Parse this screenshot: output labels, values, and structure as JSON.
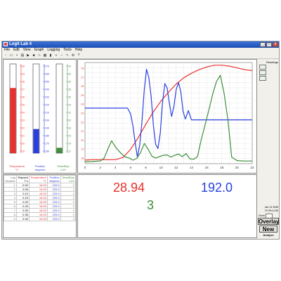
{
  "window": {
    "title": "Logit Lab 4"
  },
  "menu": [
    "File",
    "Edit",
    "View",
    "Graph",
    "Logging",
    "Tools",
    "Help"
  ],
  "meters": [
    {
      "name": "Temperature",
      "unit": "°C",
      "color": "#e8312c",
      "ticks": [
        "30",
        "29",
        "28",
        "27",
        "26",
        "25",
        "24",
        "23",
        "22",
        "21",
        "20",
        "19"
      ],
      "level": 0.73
    },
    {
      "name": "Position",
      "unit": "degrees",
      "color": "#2a3fe0",
      "ticks": [
        "270",
        "260",
        "250",
        "240",
        "230",
        "220",
        "210",
        "200",
        "190",
        "180",
        "170",
        "160"
      ],
      "level": 0.27
    },
    {
      "name": "SmartEye",
      "unit": "LUX",
      "color": "#3e8f3b",
      "ticks": [
        "34",
        "32",
        "30",
        "28",
        "26",
        "24",
        "22",
        "20",
        "18",
        "16",
        "14",
        "12"
      ],
      "level": 0.06
    }
  ],
  "table": {
    "headers": [
      "Log Number",
      "Elapsed T s",
      "Temperature °C",
      "Position degrees",
      "SmartEye LUX"
    ],
    "rows": [
      [
        "1",
        "0.00",
        "18.05",
        "225.9",
        "2"
      ],
      [
        "2",
        "0.05",
        "18.05",
        "225.9",
        "2"
      ],
      [
        "3",
        "0.10",
        "18.05",
        "225.9",
        "2"
      ],
      [
        "4",
        "0.15",
        "18.05",
        "225.9",
        "2"
      ],
      [
        "5",
        "0.20",
        "18.05",
        "225.9",
        "2"
      ],
      [
        "6",
        "0.25",
        "18.05",
        "225.9",
        "2"
      ],
      [
        "7",
        "0.30",
        "18.05",
        "225.9",
        "2"
      ],
      [
        "8",
        "0.35",
        "18.05",
        "225.9",
        "2"
      ],
      [
        "9",
        "0.40",
        "18.05",
        "225.9",
        "2"
      ]
    ]
  },
  "readouts": {
    "temperature": "28.94",
    "position": "192.0",
    "light": "3"
  },
  "sidebar": {
    "top_label": "Readings",
    "date": "Jan 13 2008",
    "time": "Fri 09:41:55",
    "zoom_label": "Zoom",
    "overlay_label": "Overlay",
    "new_label": "New",
    "analyse_label": "Analyse"
  },
  "chart_data": {
    "type": "line",
    "x_ticks": [
      "0",
      "2",
      "4",
      "6",
      "8",
      "10",
      "12",
      "14",
      "16",
      "18",
      "20",
      "22"
    ],
    "xlim": [
      0,
      22
    ],
    "left_ticks": [
      "28",
      "27",
      "26",
      "25",
      "24",
      "23",
      "22",
      "21",
      "20",
      "19",
      "18"
    ],
    "grid": true,
    "series": [
      {
        "name": "Temperature",
        "color": "#e8312c",
        "x": [
          0,
          1,
          2,
          3,
          4,
          5,
          6,
          7,
          8,
          9,
          10,
          11,
          12,
          13,
          14,
          15,
          16,
          17,
          18,
          19,
          20,
          21,
          22
        ],
        "y": [
          18.0,
          18.05,
          18.05,
          18.05,
          18.05,
          18.3,
          19.2,
          20.5,
          22.0,
          23.4,
          24.6,
          25.6,
          26.5,
          27.2,
          27.7,
          28.1,
          28.4,
          28.6,
          28.6,
          28.5,
          28.3,
          28.1,
          28.0
        ]
      },
      {
        "name": "Position",
        "color": "#2a3fe0",
        "x": [
          0,
          1,
          2,
          3,
          4,
          5,
          5.6,
          6,
          6.3,
          6.6,
          6.9,
          7.2,
          7.5,
          7.8,
          8.1,
          8.4,
          8.7,
          9,
          9.3,
          9.6,
          9.9,
          10.2,
          10.5,
          10.8,
          11.1,
          11.4,
          11.7,
          12,
          12.3,
          12.6,
          12.9,
          13.2,
          13.6,
          14,
          15,
          16,
          18,
          20,
          22
        ],
        "y": [
          225.9,
          225.9,
          225.9,
          225.9,
          225.9,
          225.9,
          225.9,
          219,
          205,
          185,
          168,
          182,
          210,
          248,
          272,
          262,
          240,
          205,
          183,
          178,
          196,
          232,
          255,
          250,
          232,
          216,
          228,
          248,
          256,
          246,
          222,
          213,
          223,
          212,
          212,
          212,
          212,
          212,
          212
        ]
      },
      {
        "name": "SmartEye",
        "color": "#3e8f3b",
        "x": [
          0,
          1,
          2,
          2.5,
          3,
          3.5,
          4,
          4.6,
          5.2,
          5.8,
          6.3,
          6.8,
          7.3,
          7.8,
          8.3,
          8.8,
          9.3,
          9.8,
          10.3,
          10.8,
          11.3,
          11.8,
          12.3,
          12.8,
          13.3,
          13.8,
          14.3,
          14.8,
          15.3,
          15.8,
          16.3,
          16.8,
          17.3,
          17.8,
          18.3,
          18.8,
          19.3,
          20,
          21,
          22
        ],
        "y": [
          12.4,
          12.5,
          12.6,
          13.2,
          15.3,
          17.2,
          15.8,
          14.6,
          13.6,
          13.3,
          12.8,
          13.2,
          14.5,
          16.6,
          15.3,
          13.7,
          13.3,
          13.6,
          13.9,
          14.0,
          13.5,
          13.9,
          14.2,
          13.6,
          14.3,
          13.1,
          13.0,
          13.6,
          17.5,
          20.8,
          24.2,
          27.8,
          30.7,
          32.1,
          28.0,
          22.0,
          13.5,
          12.7,
          12.6,
          12.6
        ]
      }
    ],
    "ranges": {
      "Temperature": [
        17.6,
        28.9
      ],
      "Position": [
        160,
        280
      ],
      "SmartEye": [
        12,
        35
      ]
    }
  }
}
